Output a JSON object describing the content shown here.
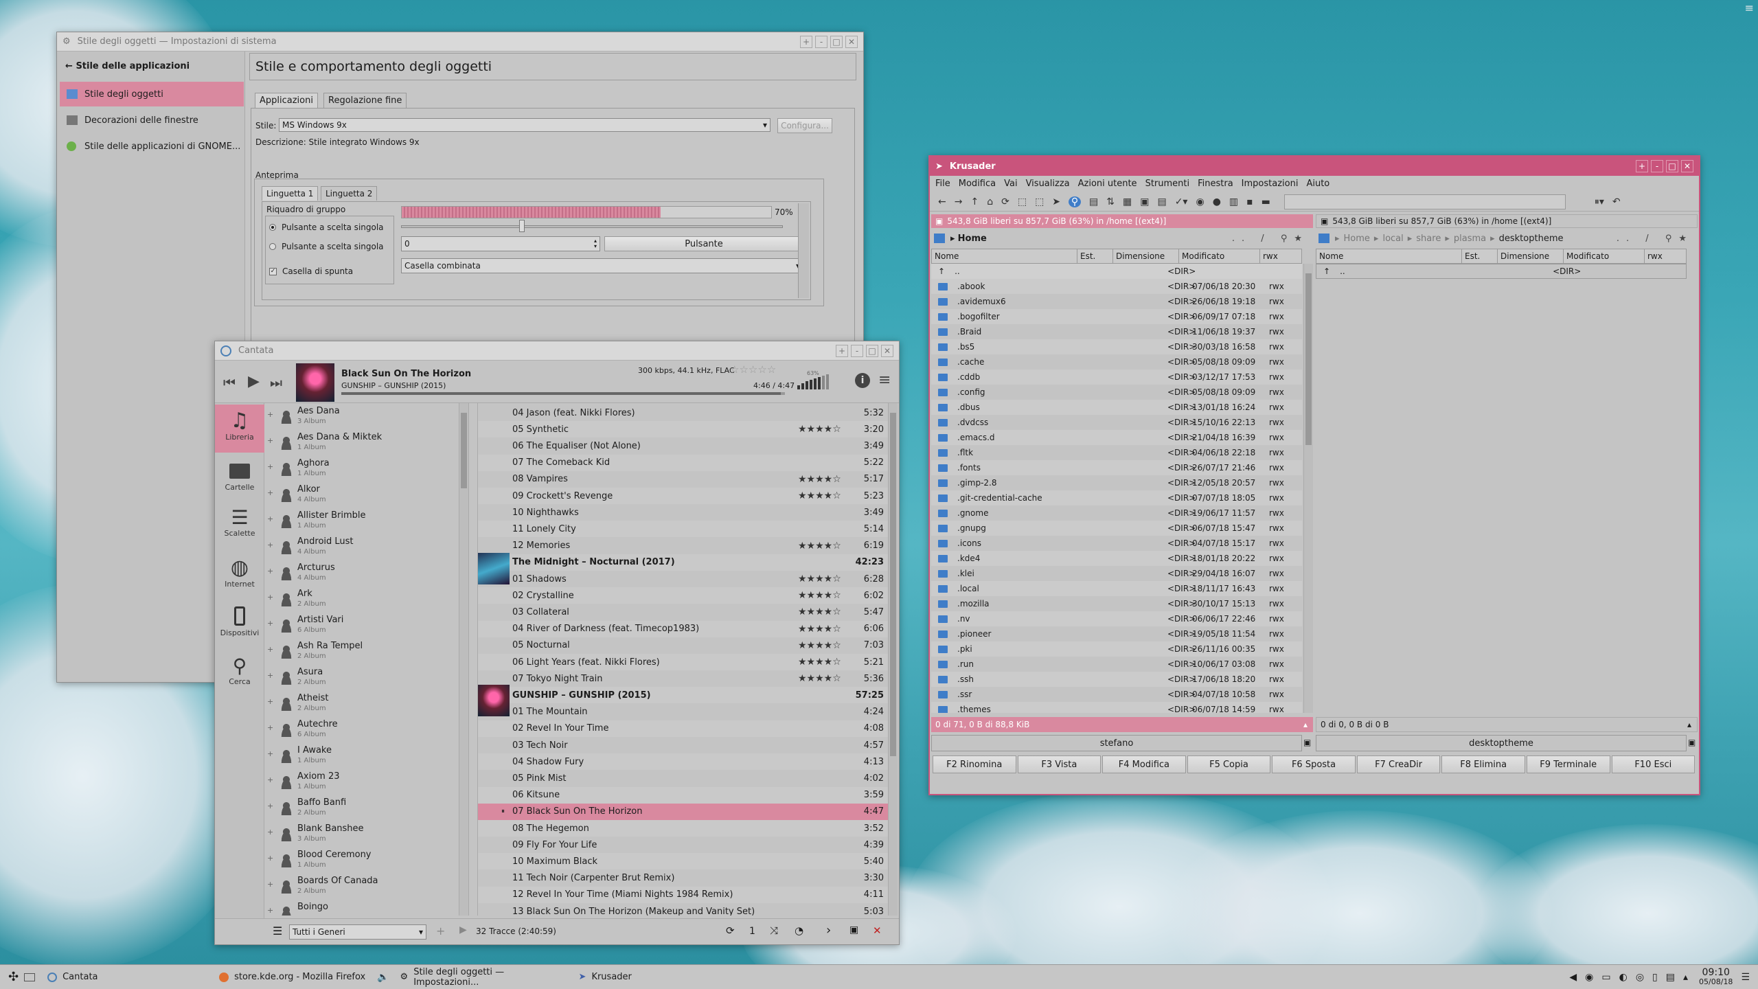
{
  "settings": {
    "title": "Stile degli oggetti — Impostazioni di sistema",
    "back": "Stile delle applicazioni",
    "nav": [
      "Stile degli oggetti",
      "Decorazioni delle finestre",
      "Stile delle applicazioni di GNOME..."
    ],
    "heading": "Stile e comportamento degli oggetti",
    "tabs": [
      "Applicazioni",
      "Regolazione fine"
    ],
    "style_label": "Stile:",
    "style_value": "MS Windows 9x",
    "configure": "Configura...",
    "description": "Descrizione: Stile integrato Windows 9x",
    "preview": "Anteprima",
    "ptabs": [
      "Linguetta 1",
      "Linguetta 2"
    ],
    "group": "Riquadro di gruppo",
    "radio1": "Pulsante a scelta singola",
    "radio2": "Pulsante a scelta singola",
    "checkbox": "Casella di spunta",
    "progress": 0.7,
    "progress_label": "70%",
    "spin": "0",
    "button": "Pulsante",
    "combo": "Casella combinata"
  },
  "cantata": {
    "title": "Cantata",
    "song": "Black Sun On The Horizon",
    "artist_album": "GUNSHIP – GUNSHIP (2015)",
    "tech": "300 kbps, 44.1 kHz, FLAC",
    "time": "4:46 / 4:47",
    "volume": "63%",
    "progress": 0.99,
    "side": [
      "Libreria",
      "Cartelle",
      "Scalette",
      "Internet",
      "Dispositivi",
      "Cerca"
    ],
    "artists": [
      [
        "Aes Dana",
        "3 Album"
      ],
      [
        "Aes Dana & Miktek",
        "1 Album"
      ],
      [
        "Aghora",
        "1 Album"
      ],
      [
        "Alkor",
        "4 Album"
      ],
      [
        "Allister Brimble",
        "1 Album"
      ],
      [
        "Android Lust",
        "4 Album"
      ],
      [
        "Arcturus",
        "4 Album"
      ],
      [
        "Ark",
        "2 Album"
      ],
      [
        "Artisti Vari",
        "6 Album"
      ],
      [
        "Ash Ra Tempel",
        "2 Album"
      ],
      [
        "Asura",
        "2 Album"
      ],
      [
        "Atheist",
        "2 Album"
      ],
      [
        "Autechre",
        "6 Album"
      ],
      [
        "I Awake",
        "1 Album"
      ],
      [
        "Axiom 23",
        "1 Album"
      ],
      [
        "Baffo Banfi",
        "2 Album"
      ],
      [
        "Blank Banshee",
        "3 Album"
      ],
      [
        "Blood Ceremony",
        "1 Album"
      ],
      [
        "Boards Of Canada",
        "2 Album"
      ],
      [
        "Boingo",
        ""
      ]
    ],
    "tracks": [
      {
        "t": "04 Jason (feat. Nikki Flores)",
        "d": "5:32",
        "r": 0
      },
      {
        "t": "05 Synthetic",
        "d": "3:20",
        "r": 4
      },
      {
        "t": "06 The Equaliser (Not Alone)",
        "d": "3:49",
        "r": 0
      },
      {
        "t": "07 The Comeback Kid",
        "d": "5:22",
        "r": 0
      },
      {
        "t": "08 Vampires",
        "d": "5:17",
        "r": 4
      },
      {
        "t": "09 Crockett's Revenge",
        "d": "5:23",
        "r": 4
      },
      {
        "t": "10 Nighthawks",
        "d": "3:49",
        "r": 0
      },
      {
        "t": "11 Lonely City",
        "d": "5:14",
        "r": 0
      },
      {
        "t": "12 Memories",
        "d": "6:19",
        "r": 4
      },
      {
        "t": "The Midnight – Nocturnal (2017)",
        "d": "42:23",
        "h": 1
      },
      {
        "t": "01 Shadows",
        "d": "6:28",
        "r": 4
      },
      {
        "t": "02 Crystalline",
        "d": "6:02",
        "r": 4
      },
      {
        "t": "03 Collateral",
        "d": "5:47",
        "r": 4
      },
      {
        "t": "04 River of Darkness (feat. Timecop1983)",
        "d": "6:06",
        "r": 4
      },
      {
        "t": "05 Nocturnal",
        "d": "7:03",
        "r": 4
      },
      {
        "t": "06 Light Years (feat. Nikki Flores)",
        "d": "5:21",
        "r": 4
      },
      {
        "t": "07 Tokyo Night Train",
        "d": "5:36",
        "r": 4
      },
      {
        "t": "GUNSHIP – GUNSHIP (2015)",
        "d": "57:25",
        "h": 1
      },
      {
        "t": "01 The Mountain",
        "d": "4:24",
        "r": 0
      },
      {
        "t": "02 Revel In Your Time",
        "d": "4:08",
        "r": 0
      },
      {
        "t": "03 Tech Noir",
        "d": "4:57",
        "r": 0
      },
      {
        "t": "04 Shadow Fury",
        "d": "4:13",
        "r": 0
      },
      {
        "t": "05 Pink Mist",
        "d": "4:02",
        "r": 0
      },
      {
        "t": "06 Kitsune",
        "d": "3:59",
        "r": 0
      },
      {
        "t": "07 Black Sun On The Horizon",
        "d": "4:47",
        "r": 0,
        "p": 1
      },
      {
        "t": "08 The Hegemon",
        "d": "3:52",
        "r": 0
      },
      {
        "t": "09 Fly For Your Life",
        "d": "4:39",
        "r": 0
      },
      {
        "t": "10 Maximum Black",
        "d": "5:40",
        "r": 0
      },
      {
        "t": "11 Tech Noir (Carpenter Brut Remix)",
        "d": "3:30",
        "r": 0
      },
      {
        "t": "12 Revel In Your Time (Miami Nights 1984 Remix)",
        "d": "4:11",
        "r": 0
      },
      {
        "t": "13 Black Sun On The Horizon (Makeup and Vanity Set)",
        "d": "5:03",
        "r": 0
      }
    ],
    "genre": "Tutti i Generi",
    "count": "32 Tracce (2:40:59)",
    "one": "1"
  },
  "krusader": {
    "title": "Krusader",
    "menu": [
      "File",
      "Modifica",
      "Vai",
      "Visualizza",
      "Azioni utente",
      "Strumenti",
      "Finestra",
      "Impostazioni",
      "Aiuto"
    ],
    "left_free": "543,8 GiB liberi su 857,7 GiB (63%) in /home [(ext4)]",
    "right_free": "543,8 GiB liberi su 857,7 GiB (63%) in /home [(ext4)]",
    "left_path": "Home",
    "right_path": [
      "Home",
      "local",
      "share",
      "plasma",
      "desktoptheme"
    ],
    "cols": [
      "Nome",
      "Est.",
      "Dimensione",
      "Modificato",
      "rwx"
    ],
    "updir": "..",
    "dir": "<DIR>",
    "files": [
      [
        ".abook",
        "07/06/18 20:30"
      ],
      [
        ".avidemux6",
        "26/06/18 19:18"
      ],
      [
        ".bogofilter",
        "06/09/17 07:18"
      ],
      [
        ".Braid",
        "11/06/18 19:37"
      ],
      [
        ".bs5",
        "30/03/18 16:58"
      ],
      [
        ".cache",
        "05/08/18 09:09"
      ],
      [
        ".cddb",
        "03/12/17 17:53"
      ],
      [
        ".config",
        "05/08/18 09:09"
      ],
      [
        ".dbus",
        "13/01/18 16:24"
      ],
      [
        ".dvdcss",
        "15/10/16 22:13"
      ],
      [
        ".emacs.d",
        "21/04/18 16:39"
      ],
      [
        ".fltk",
        "04/06/18 22:18"
      ],
      [
        ".fonts",
        "26/07/17 21:46"
      ],
      [
        ".gimp-2.8",
        "12/05/18 20:57"
      ],
      [
        ".git-credential-cache",
        "07/07/18 18:05"
      ],
      [
        ".gnome",
        "19/06/17 11:57"
      ],
      [
        ".gnupg",
        "06/07/18 15:47"
      ],
      [
        ".icons",
        "04/07/18 15:17"
      ],
      [
        ".kde4",
        "18/01/18 20:22"
      ],
      [
        ".klei",
        "29/04/18 16:07"
      ],
      [
        ".local",
        "18/11/17 16:43"
      ],
      [
        ".mozilla",
        "30/10/17 15:13"
      ],
      [
        ".nv",
        "06/06/17 22:46"
      ],
      [
        ".pioneer",
        "19/05/18 11:54"
      ],
      [
        ".pki",
        "26/11/16 00:35"
      ],
      [
        ".run",
        "10/06/17 03:08"
      ],
      [
        ".ssh",
        "17/06/18 18:20"
      ],
      [
        ".ssr",
        "04/07/18 10:58"
      ],
      [
        ".themes",
        "06/07/18 14:59"
      ]
    ],
    "perm": "rwx",
    "left_status": "0 di 71, 0 B di 88,8 KiB",
    "right_status": "0 di 0, 0 B di 0 B",
    "left_name": "stefano",
    "right_name": "desktoptheme",
    "fkeys": [
      "F2 Rinomina",
      "F3 Vista",
      "F4 Modifica",
      "F5 Copia",
      "F6 Sposta",
      "F7 CreaDir",
      "F8 Elimina",
      "F9 Terminale",
      "F10 Esci"
    ]
  },
  "taskbar": {
    "items": [
      "Cantata",
      "store.kde.org - Mozilla Firefox",
      "Stile degli oggetti — Impostazioni...",
      "Krusader"
    ],
    "time": "09:10",
    "date": "05/08/18"
  }
}
